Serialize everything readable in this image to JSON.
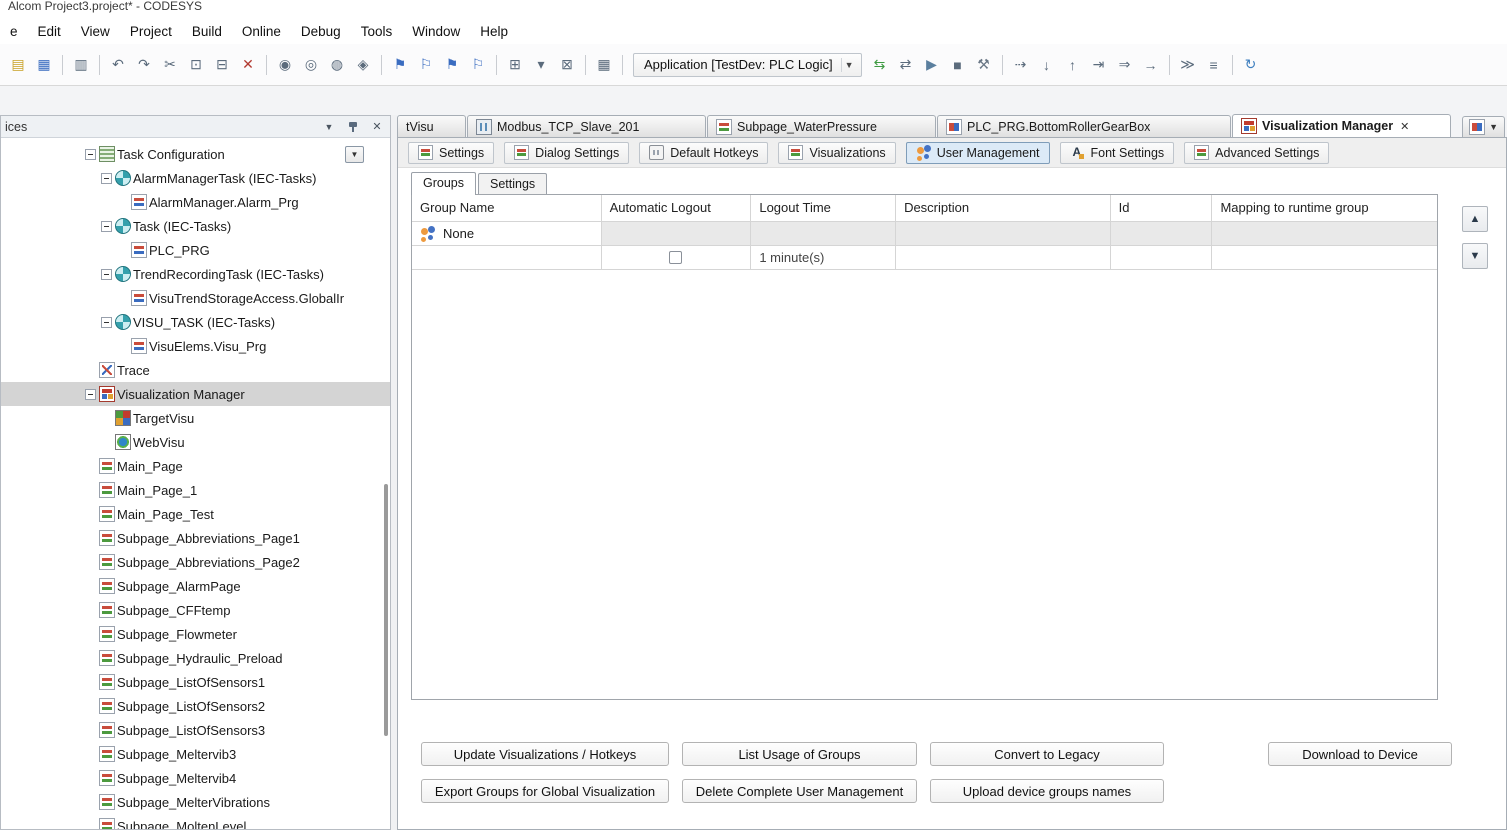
{
  "window": {
    "title": "Alcom Project3.project* - CODESYS"
  },
  "colors": {
    "selection_gray": "#d4d4d4",
    "disabled_row_bg": "#e9e9e9",
    "accent_blue": "#3a6cc0",
    "accent_red": "#c23b2e"
  },
  "menubar": {
    "items": [
      "e",
      "Edit",
      "View",
      "Project",
      "Build",
      "Online",
      "Debug",
      "Tools",
      "Window",
      "Help"
    ]
  },
  "toolbar": {
    "application_selector": "Application [TestDev: PLC Logic]",
    "icons_a": [
      {
        "name": "open-project-icon",
        "glyph": "▤",
        "kind": "icon",
        "interactable": "true"
      },
      {
        "name": "save-icon",
        "glyph": "▦",
        "kind": "icon",
        "interactable": "true"
      },
      {
        "name": "toolbar-separator",
        "glyph": "",
        "kind": "sep",
        "interactable": "false"
      },
      {
        "name": "print-icon",
        "glyph": "▥",
        "kind": "icon",
        "interactable": "true"
      },
      {
        "name": "toolbar-separator",
        "glyph": "",
        "kind": "sep",
        "interactable": "false"
      },
      {
        "name": "undo-icon",
        "glyph": "↶",
        "kind": "icon",
        "interactable": "true"
      },
      {
        "name": "redo-icon",
        "glyph": "↷",
        "kind": "icon",
        "interactable": "true"
      },
      {
        "name": "cut-icon",
        "glyph": "✂",
        "kind": "icon",
        "interactable": "true"
      },
      {
        "name": "copy-icon",
        "glyph": "⊡",
        "kind": "icon",
        "interactable": "true"
      },
      {
        "name": "paste-icon",
        "glyph": "⊟",
        "kind": "icon",
        "interactable": "true"
      },
      {
        "name": "delete-icon",
        "glyph": "✕",
        "kind": "icon",
        "interactable": "true"
      },
      {
        "name": "toolbar-separator",
        "glyph": "",
        "kind": "sep",
        "interactable": "false"
      },
      {
        "name": "find-icon",
        "glyph": "◉",
        "kind": "icon",
        "interactable": "true"
      },
      {
        "name": "find-next-icon",
        "glyph": "◎",
        "kind": "icon",
        "interactable": "true"
      },
      {
        "name": "find-previous-icon",
        "glyph": "◍",
        "kind": "icon",
        "interactable": "true"
      },
      {
        "name": "replace-icon",
        "glyph": "◈",
        "kind": "icon",
        "interactable": "true"
      },
      {
        "name": "toolbar-separator",
        "glyph": "",
        "kind": "sep",
        "interactable": "false"
      },
      {
        "name": "bookmark-toggle-icon",
        "glyph": "⚑",
        "kind": "icon",
        "interactable": "true"
      },
      {
        "name": "bookmark-next-icon",
        "glyph": "⚐",
        "kind": "icon",
        "interactable": "true"
      },
      {
        "name": "bookmark-previous-icon",
        "glyph": "⚑",
        "kind": "icon",
        "interactable": "true"
      },
      {
        "name": "bookmark-clear-icon",
        "glyph": "⚐",
        "kind": "icon",
        "interactable": "true"
      },
      {
        "name": "toolbar-separator",
        "glyph": "",
        "kind": "sep",
        "interactable": "false"
      },
      {
        "name": "paste-special-icon",
        "glyph": "⊞",
        "kind": "icon",
        "interactable": "true"
      },
      {
        "name": "insert-assistant-icon",
        "glyph": "▾",
        "kind": "icon",
        "interactable": "true"
      },
      {
        "name": "new-window-icon",
        "glyph": "⊠",
        "kind": "icon",
        "interactable": "true"
      },
      {
        "name": "toolbar-separator",
        "glyph": "",
        "kind": "sep",
        "interactable": "false"
      },
      {
        "name": "build-icon",
        "glyph": "▦",
        "kind": "icon",
        "interactable": "true"
      },
      {
        "name": "toolbar-separator",
        "glyph": "",
        "kind": "sep",
        "interactable": "false"
      }
    ],
    "icons_b": [
      {
        "name": "login-icon",
        "glyph": "⇆",
        "kind": "icon",
        "interactable": "true"
      },
      {
        "name": "logout-icon",
        "glyph": "⇄",
        "kind": "icon",
        "interactable": "true"
      },
      {
        "name": "start-icon",
        "glyph": "▶",
        "kind": "icon",
        "interactable": "true"
      },
      {
        "name": "stop-icon",
        "glyph": "■",
        "kind": "icon",
        "interactable": "true"
      },
      {
        "name": "wrench-icon",
        "glyph": "⚒",
        "kind": "icon",
        "interactable": "true"
      },
      {
        "name": "toolbar-separator",
        "glyph": "",
        "kind": "sep",
        "interactable": "false"
      },
      {
        "name": "step-over-icon",
        "glyph": "⇢",
        "kind": "icon",
        "interactable": "true"
      },
      {
        "name": "step-into-icon",
        "glyph": "↓",
        "kind": "icon",
        "interactable": "true"
      },
      {
        "name": "step-out-icon",
        "glyph": "↑",
        "kind": "icon",
        "interactable": "true"
      },
      {
        "name": "run-to-cursor-icon",
        "glyph": "⇥",
        "kind": "icon",
        "interactable": "true"
      },
      {
        "name": "set-next-statement-icon",
        "glyph": "⇒",
        "kind": "icon",
        "interactable": "true"
      },
      {
        "name": "show-next-statement-icon",
        "glyph": "→",
        "kind": "icon",
        "interactable": "true"
      },
      {
        "name": "toolbar-separator",
        "glyph": "",
        "kind": "sep",
        "interactable": "false"
      },
      {
        "name": "flow-control-icon",
        "glyph": "≫",
        "kind": "icon",
        "interactable": "true"
      },
      {
        "name": "execution-order-icon",
        "glyph": "≡",
        "kind": "icon",
        "interactable": "true"
      },
      {
        "name": "toolbar-separator",
        "glyph": "",
        "kind": "sep",
        "interactable": "false"
      },
      {
        "name": "refresh-icon",
        "glyph": "↻",
        "kind": "icon",
        "interactable": "true"
      }
    ]
  },
  "devices": {
    "title": "ices",
    "items": [
      {
        "label": "Task Configuration",
        "level": 0,
        "icon": "taskcfg",
        "icon_name": "task-configuration-icon",
        "expand": "minus",
        "selected": "false",
        "dropdown": "true"
      },
      {
        "label": "AlarmManagerTask (IEC-Tasks)",
        "level": 1,
        "icon": "task",
        "icon_name": "iec-task-icon",
        "expand": "minus",
        "selected": "false",
        "dropdown": "false"
      },
      {
        "label": "AlarmManager.Alarm_Prg",
        "level": 2,
        "icon": "prg",
        "icon_name": "program-call-icon",
        "expand": "leaf",
        "selected": "false",
        "dropdown": "false"
      },
      {
        "label": "Task (IEC-Tasks)",
        "level": 1,
        "icon": "task",
        "icon_name": "iec-task-icon",
        "expand": "minus",
        "selected": "false",
        "dropdown": "false"
      },
      {
        "label": "PLC_PRG",
        "level": 2,
        "icon": "prg",
        "icon_name": "program-call-icon",
        "expand": "leaf",
        "selected": "false",
        "dropdown": "false"
      },
      {
        "label": "TrendRecordingTask (IEC-Tasks)",
        "level": 1,
        "icon": "task",
        "icon_name": "iec-task-icon",
        "expand": "minus",
        "selected": "false",
        "dropdown": "false"
      },
      {
        "label": "VisuTrendStorageAccess.GlobalIr",
        "level": 2,
        "icon": "prg",
        "icon_name": "program-call-icon",
        "expand": "leaf",
        "selected": "false",
        "dropdown": "false"
      },
      {
        "label": "VISU_TASK (IEC-Tasks)",
        "level": 1,
        "icon": "task",
        "icon_name": "iec-task-icon",
        "expand": "minus",
        "selected": "false",
        "dropdown": "false"
      },
      {
        "label": "VisuElems.Visu_Prg",
        "level": 2,
        "icon": "prg",
        "icon_name": "program-call-icon",
        "expand": "leaf",
        "selected": "false",
        "dropdown": "false"
      },
      {
        "label": "Trace",
        "level": 0,
        "icon": "trace",
        "icon_name": "trace-icon",
        "expand": "leaf",
        "selected": "false",
        "dropdown": "false"
      },
      {
        "label": "Visualization Manager",
        "level": 0,
        "icon": "vmgr",
        "icon_name": "visualization-manager-icon",
        "expand": "minus",
        "selected": "true",
        "dropdown": "false"
      },
      {
        "label": "TargetVisu",
        "level": 1,
        "icon": "targetvisu",
        "icon_name": "targetvisu-icon",
        "expand": "leaf",
        "selected": "false",
        "dropdown": "false"
      },
      {
        "label": "WebVisu",
        "level": 1,
        "icon": "webvisu",
        "icon_name": "webvisu-icon",
        "expand": "leaf",
        "selected": "false",
        "dropdown": "false"
      },
      {
        "label": "Main_Page",
        "level": 0,
        "icon": "visupage",
        "icon_name": "visualization-page-icon",
        "expand": "leaf",
        "selected": "false",
        "dropdown": "false"
      },
      {
        "label": "Main_Page_1",
        "level": 0,
        "icon": "visupage",
        "icon_name": "visualization-page-icon",
        "expand": "leaf",
        "selected": "false",
        "dropdown": "false"
      },
      {
        "label": "Main_Page_Test",
        "level": 0,
        "icon": "visupage",
        "icon_name": "visualization-page-icon",
        "expand": "leaf",
        "selected": "false",
        "dropdown": "false"
      },
      {
        "label": "Subpage_Abbreviations_Page1",
        "level": 0,
        "icon": "visupage",
        "icon_name": "visualization-page-icon",
        "expand": "leaf",
        "selected": "false",
        "dropdown": "false"
      },
      {
        "label": "Subpage_Abbreviations_Page2",
        "level": 0,
        "icon": "visupage",
        "icon_name": "visualization-page-icon",
        "expand": "leaf",
        "selected": "false",
        "dropdown": "false"
      },
      {
        "label": "Subpage_AlarmPage",
        "level": 0,
        "icon": "visupage",
        "icon_name": "visualization-page-icon",
        "expand": "leaf",
        "selected": "false",
        "dropdown": "false"
      },
      {
        "label": "Subpage_CFFtemp",
        "level": 0,
        "icon": "visupage",
        "icon_name": "visualization-page-icon",
        "expand": "leaf",
        "selected": "false",
        "dropdown": "false"
      },
      {
        "label": "Subpage_Flowmeter",
        "level": 0,
        "icon": "visupage",
        "icon_name": "visualization-page-icon",
        "expand": "leaf",
        "selected": "false",
        "dropdown": "false"
      },
      {
        "label": "Subpage_Hydraulic_Preload",
        "level": 0,
        "icon": "visupage",
        "icon_name": "visualization-page-icon",
        "expand": "leaf",
        "selected": "false",
        "dropdown": "false"
      },
      {
        "label": "Subpage_ListOfSensors1",
        "level": 0,
        "icon": "visupage",
        "icon_name": "visualization-page-icon",
        "expand": "leaf",
        "selected": "false",
        "dropdown": "false"
      },
      {
        "label": "Subpage_ListOfSensors2",
        "level": 0,
        "icon": "visupage",
        "icon_name": "visualization-page-icon",
        "expand": "leaf",
        "selected": "false",
        "dropdown": "false"
      },
      {
        "label": "Subpage_ListOfSensors3",
        "level": 0,
        "icon": "visupage",
        "icon_name": "visualization-page-icon",
        "expand": "leaf",
        "selected": "false",
        "dropdown": "false"
      },
      {
        "label": "Subpage_Meltervib3",
        "level": 0,
        "icon": "visupage",
        "icon_name": "visualization-page-icon",
        "expand": "leaf",
        "selected": "false",
        "dropdown": "false"
      },
      {
        "label": "Subpage_Meltervib4",
        "level": 0,
        "icon": "visupage",
        "icon_name": "visualization-page-icon",
        "expand": "leaf",
        "selected": "false",
        "dropdown": "false"
      },
      {
        "label": "Subpage_MelterVibrations",
        "level": 0,
        "icon": "visupage",
        "icon_name": "visualization-page-icon",
        "expand": "leaf",
        "selected": "false",
        "dropdown": "false"
      },
      {
        "label": "Subpage_MoltenLevel",
        "level": 0,
        "icon": "visupage",
        "icon_name": "visualization-page-icon",
        "expand": "leaf",
        "selected": "false",
        "dropdown": "false"
      }
    ]
  },
  "editor": {
    "doc_tabs": [
      {
        "label": "tVisu",
        "icon": "none",
        "icon_name": "no-icon",
        "active": "false"
      },
      {
        "label": "Modbus_TCP_Slave_201",
        "icon": "device",
        "icon_name": "modbus-device-icon",
        "active": "false"
      },
      {
        "label": "Subpage_WaterPressure",
        "icon": "visupage",
        "icon_name": "visualization-page-icon",
        "active": "false"
      },
      {
        "label": "PLC_PRG.BottomRollerGearBox",
        "icon": "pou",
        "icon_name": "pou-editor-icon",
        "active": "false"
      },
      {
        "label": "Visualization Manager",
        "icon": "vmgr",
        "icon_name": "visualization-manager-icon",
        "active": "true"
      }
    ],
    "manager_tabs": [
      {
        "label": "Settings",
        "icon": "visupage",
        "icon_name": "settings-tab-icon",
        "active": "false"
      },
      {
        "label": "Dialog Settings",
        "icon": "visupage",
        "icon_name": "dialog-settings-tab-icon",
        "active": "false"
      },
      {
        "label": "Default Hotkeys",
        "icon": "hotkeys",
        "icon_name": "default-hotkeys-tab-icon",
        "active": "false"
      },
      {
        "label": "Visualizations",
        "icon": "visupage",
        "icon_name": "visualizations-tab-icon",
        "active": "false"
      },
      {
        "label": "User Management",
        "icon": "users-special",
        "icon_name": "user-management-tab-icon",
        "active": "true"
      },
      {
        "label": "Font Settings",
        "icon": "font",
        "icon_name": "font-settings-tab-icon",
        "active": "false"
      },
      {
        "label": "Advanced Settings",
        "icon": "visupage",
        "icon_name": "advanced-settings-tab-icon",
        "active": "false"
      }
    ],
    "subtabs": [
      {
        "label": "Groups",
        "active": "true"
      },
      {
        "label": "Settings",
        "active": "false"
      }
    ],
    "table": {
      "columns": [
        {
          "label": "Group Name"
        },
        {
          "label": "Automatic Logout"
        },
        {
          "label": "Logout Time"
        },
        {
          "label": "Description"
        },
        {
          "label": "Id"
        },
        {
          "label": "Mapping to runtime group"
        }
      ],
      "rows": [
        {
          "group_name": "None"
        },
        {
          "automatic_logout_checked": false,
          "logout_time": "1 minute(s)"
        }
      ]
    },
    "actions": {
      "row1": [
        "Update Visualizations / Hotkeys",
        "List Usage of Groups",
        "Convert to Legacy",
        "Download to Device"
      ],
      "row2": [
        "Export Groups for Global Visualization",
        "Delete Complete User Management",
        "Upload device groups names"
      ]
    }
  }
}
